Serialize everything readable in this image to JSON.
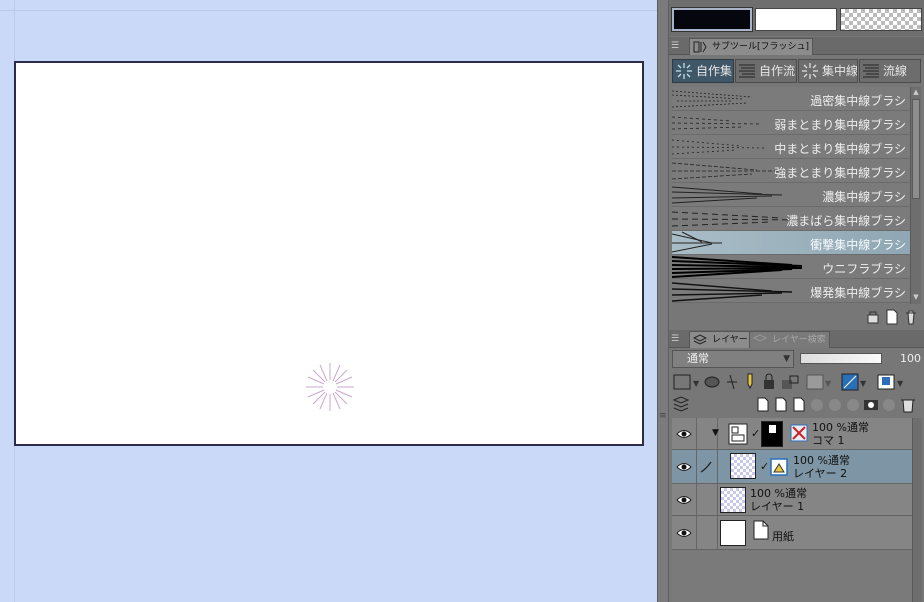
{
  "colors": {
    "canvas_bg": "#cad9f7",
    "panel_bg": "#777777",
    "selected_group": "#3f5766",
    "selected_brush": "#9ab0bd",
    "main_color": "#06060f",
    "sub_color": "#ffffff"
  },
  "color_swatches": {
    "main_icon": "main-color",
    "sub_icon": "sub-color",
    "transparent_icon": "transparent-color"
  },
  "subtool_panel": {
    "tab_label": "サブツール[フラッシュ]",
    "tab_icon": "subtool-icon",
    "groups": [
      {
        "label": "自作集",
        "icon": "burst-icon",
        "active": true
      },
      {
        "label": "自作流",
        "icon": "flow-lines-icon",
        "active": false
      },
      {
        "label": "集中線",
        "icon": "burst-icon",
        "active": false
      },
      {
        "label": "流線",
        "icon": "flow-lines-icon",
        "active": false
      }
    ],
    "brushes": [
      {
        "label": "過密集中線ブラシ",
        "selected": false
      },
      {
        "label": "弱まとまり集中線ブラシ",
        "selected": false
      },
      {
        "label": "中まとまり集中線ブラシ",
        "selected": false
      },
      {
        "label": "強まとまり集中線ブラシ",
        "selected": false
      },
      {
        "label": "濃集中線ブラシ",
        "selected": false
      },
      {
        "label": "濃まばら集中線ブラシ",
        "selected": false
      },
      {
        "label": "衝撃集中線ブラシ",
        "selected": true
      },
      {
        "label": "ウニフラブラシ",
        "selected": false
      },
      {
        "label": "爆発集中線ブラシ",
        "selected": false
      }
    ],
    "footer_icons": [
      "settings-icon",
      "new-page-icon",
      "trash-icon"
    ]
  },
  "layer_panel": {
    "tabs": [
      {
        "label": "レイヤー",
        "active": true
      },
      {
        "label": "レイヤー検索",
        "active": false
      }
    ],
    "blend_mode": "通常",
    "opacity": "100",
    "opacity_fraction": 1.0,
    "layers": [
      {
        "line1": "100 %通常",
        "line2": "コマ 1",
        "type": "frame",
        "selected": false,
        "visible": true
      },
      {
        "line1": "100 %通常",
        "line2": "レイヤー 2",
        "type": "raster",
        "selected": true,
        "visible": true
      },
      {
        "line1": "100 %通常",
        "line2": "レイヤー 1",
        "type": "raster",
        "selected": false,
        "visible": true
      },
      {
        "line1": "",
        "line2": "用紙",
        "type": "paper",
        "selected": false,
        "visible": true
      }
    ]
  }
}
